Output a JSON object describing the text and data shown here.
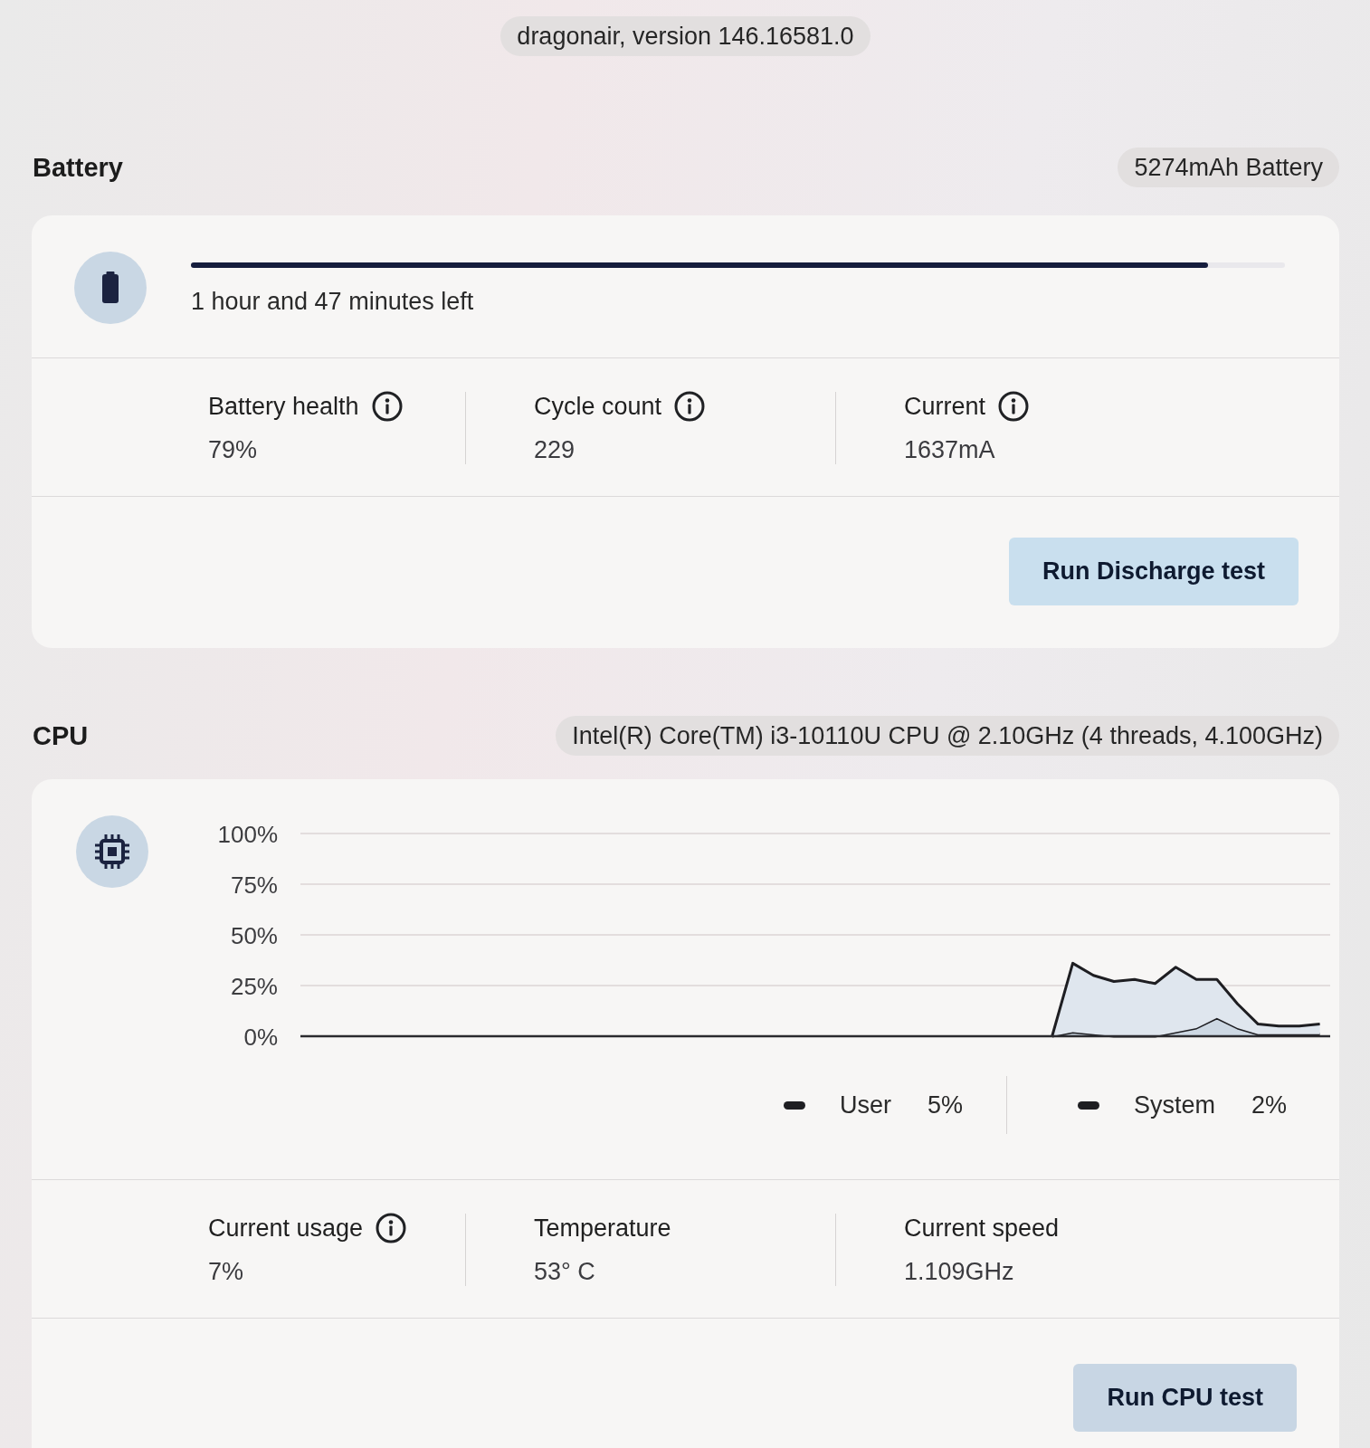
{
  "version_tag": "dragonair, version 146.16581.0",
  "battery": {
    "title": "Battery",
    "tag": "5274mAh Battery",
    "progress": {
      "level": 0.93
    },
    "time_left": "1 hour and 47 minutes left",
    "stats": [
      {
        "label": "Battery health",
        "info": true,
        "value": "79%"
      },
      {
        "label": "Cycle count",
        "info": true,
        "value": "229"
      },
      {
        "label": "Current",
        "info": true,
        "value": "1637mA"
      }
    ],
    "button": "Run Discharge test"
  },
  "cpu": {
    "title": "CPU",
    "tag": "Intel(R) Core(TM) i3-10110U CPU @ 2.10GHz (4 threads, 4.100GHz)",
    "chart_data": {
      "type": "area",
      "stacked": true,
      "grid": true,
      "categories": [
        null,
        null,
        null,
        null,
        null,
        null,
        null,
        null,
        null,
        null,
        null,
        null,
        null,
        null,
        null,
        null,
        null,
        null,
        null,
        null,
        null,
        null,
        null,
        null,
        null,
        null,
        null,
        null,
        null,
        null,
        null,
        null,
        null,
        null,
        null,
        null,
        null,
        null,
        null,
        null,
        null,
        null,
        null,
        null,
        null,
        null,
        null,
        null,
        null,
        null
      ],
      "ylim": [
        0,
        100
      ],
      "yticks": [
        {
          "value": 0,
          "label": "0%"
        },
        {
          "value": 25,
          "label": "25%"
        },
        {
          "value": 50,
          "label": "50%"
        },
        {
          "value": 75,
          "label": "75%"
        },
        {
          "value": 100,
          "label": "100%"
        }
      ],
      "series": [
        {
          "name": "System",
          "values": [
            null,
            null,
            null,
            null,
            null,
            null,
            null,
            null,
            null,
            null,
            null,
            null,
            null,
            null,
            null,
            null,
            null,
            null,
            null,
            null,
            null,
            null,
            null,
            null,
            null,
            null,
            null,
            null,
            null,
            null,
            null,
            null,
            null,
            null,
            null,
            null,
            0,
            2,
            1,
            0,
            0,
            0,
            2,
            4,
            9,
            4,
            1,
            1,
            1,
            1
          ]
        },
        {
          "name": "User",
          "values": [
            null,
            null,
            null,
            null,
            null,
            null,
            null,
            null,
            null,
            null,
            null,
            null,
            null,
            null,
            null,
            null,
            null,
            null,
            null,
            null,
            null,
            null,
            null,
            null,
            null,
            null,
            null,
            null,
            null,
            null,
            null,
            null,
            null,
            null,
            null,
            null,
            0,
            34,
            29,
            27,
            28,
            26,
            32,
            24,
            19,
            12,
            5,
            4,
            4,
            5
          ]
        }
      ]
    },
    "legend_readings": [
      "5%",
      "2%"
    ],
    "stats": [
      {
        "label": "Current usage",
        "info": true,
        "value": "7%"
      },
      {
        "label": "Temperature",
        "info": false,
        "value": "53° C"
      },
      {
        "label": "Current speed",
        "info": false,
        "value": "1.109GHz"
      }
    ],
    "button": "Run CPU test"
  }
}
